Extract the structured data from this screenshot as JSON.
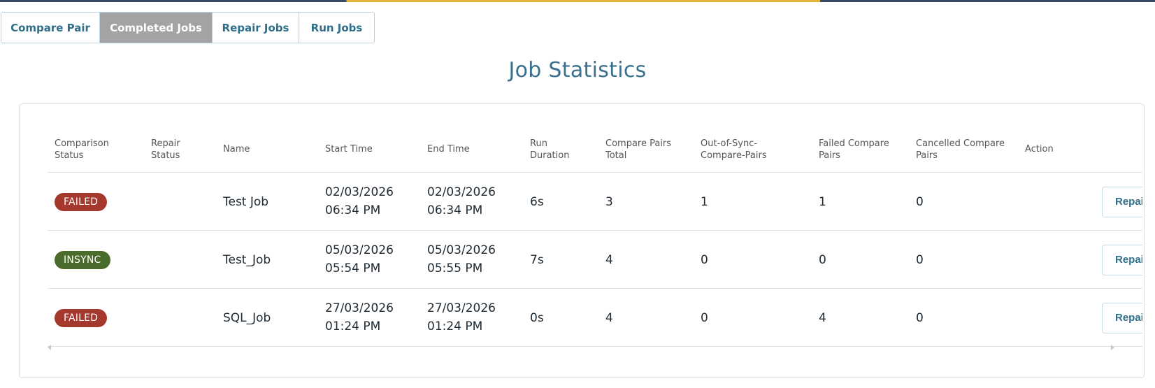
{
  "tabs": [
    {
      "label": "Compare Pair",
      "active": false
    },
    {
      "label": "Completed Jobs",
      "active": true
    },
    {
      "label": "Repair Jobs",
      "active": false
    },
    {
      "label": "Run Jobs",
      "active": false
    }
  ],
  "page_title": "Job Statistics",
  "table": {
    "headers": {
      "comparison_status": [
        "Comparison",
        "Status"
      ],
      "repair_status": [
        "Repair",
        "Status"
      ],
      "name": [
        "Name"
      ],
      "start_time": [
        "Start Time"
      ],
      "end_time": [
        "End Time"
      ],
      "run_duration": [
        "Run",
        "Duration"
      ],
      "compare_pairs_total": [
        "Compare Pairs",
        "Total"
      ],
      "out_of_sync": [
        "Out-of-Sync-",
        "Compare-Pairs"
      ],
      "failed_pairs": [
        "Failed Compare",
        "Pairs"
      ],
      "cancelled_pairs": [
        "Cancelled Compare",
        "Pairs"
      ],
      "action": [
        "Action"
      ]
    },
    "rows": [
      {
        "comparison_status": "FAILED",
        "status_kind": "failed",
        "repair_status": "",
        "name": "Test Job",
        "start_date": "02/03/2026",
        "start_clock": "06:34 PM",
        "end_date": "02/03/2026",
        "end_clock": "06:34 PM",
        "run_duration": "6s",
        "compare_pairs_total": "3",
        "out_of_sync": "1",
        "failed_pairs": "1",
        "cancelled_pairs": "0",
        "action_label": "Repair"
      },
      {
        "comparison_status": "INSYNC",
        "status_kind": "insync",
        "repair_status": "",
        "name": "Test_Job",
        "start_date": "05/03/2026",
        "start_clock": "05:54 PM",
        "end_date": "05/03/2026",
        "end_clock": "05:55 PM",
        "run_duration": "7s",
        "compare_pairs_total": "4",
        "out_of_sync": "0",
        "failed_pairs": "0",
        "cancelled_pairs": "0",
        "action_label": "Repair"
      },
      {
        "comparison_status": "FAILED",
        "status_kind": "failed",
        "repair_status": "",
        "name": "SQL_Job",
        "start_date": "27/03/2026",
        "start_clock": "01:24 PM",
        "end_date": "27/03/2026",
        "end_clock": "01:24 PM",
        "run_duration": "0s",
        "compare_pairs_total": "4",
        "out_of_sync": "0",
        "failed_pairs": "4",
        "cancelled_pairs": "0",
        "action_label": "Repair"
      }
    ]
  },
  "colors": {
    "accent": "#2f6f8a",
    "title": "#3a6f8e",
    "failed_badge": "#a5382d",
    "insync_badge": "#4a6b2b",
    "active_tab": "#a3a3a3"
  }
}
